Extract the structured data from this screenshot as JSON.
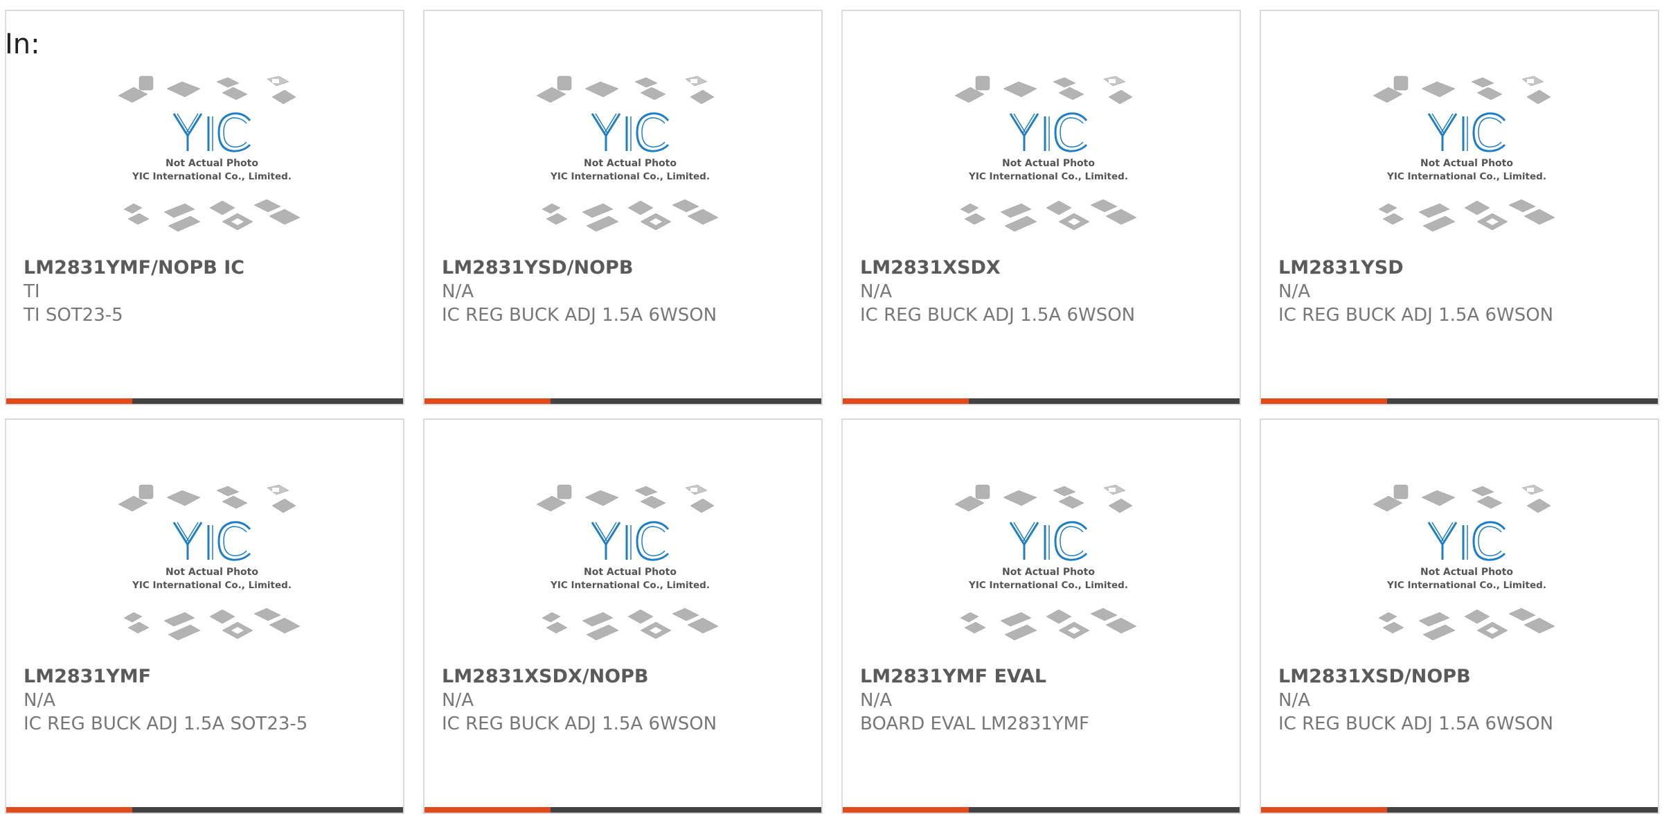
{
  "header": {
    "in_label": "In:"
  },
  "thumbnail": {
    "logo_text": "YIC",
    "caption_line1": "Not Actual Photo",
    "caption_line2": "YIC International Co., Limited."
  },
  "colors": {
    "accent": "#e24a1c",
    "bar_dark": "#434343",
    "logo_blue": "#1f7ec4"
  },
  "cards": [
    {
      "title": "LM2831YMF/NOPB IC",
      "brand": "TI",
      "desc": "TI SOT23-5"
    },
    {
      "title": "LM2831YSD/NOPB",
      "brand": "N/A",
      "desc": "IC REG BUCK ADJ 1.5A 6WSON"
    },
    {
      "title": "LM2831XSDX",
      "brand": "N/A",
      "desc": "IC REG BUCK ADJ 1.5A 6WSON"
    },
    {
      "title": "LM2831YSD",
      "brand": "N/A",
      "desc": "IC REG BUCK ADJ 1.5A 6WSON"
    },
    {
      "title": "LM2831YMF",
      "brand": "N/A",
      "desc": "IC REG BUCK ADJ 1.5A SOT23-5"
    },
    {
      "title": "LM2831XSDX/NOPB",
      "brand": "N/A",
      "desc": "IC REG BUCK ADJ 1.5A 6WSON"
    },
    {
      "title": "LM2831YMF EVAL",
      "brand": "N/A",
      "desc": "BOARD EVAL LM2831YMF"
    },
    {
      "title": "LM2831XSD/NOPB",
      "brand": "N/A",
      "desc": "IC REG BUCK ADJ 1.5A 6WSON"
    }
  ]
}
